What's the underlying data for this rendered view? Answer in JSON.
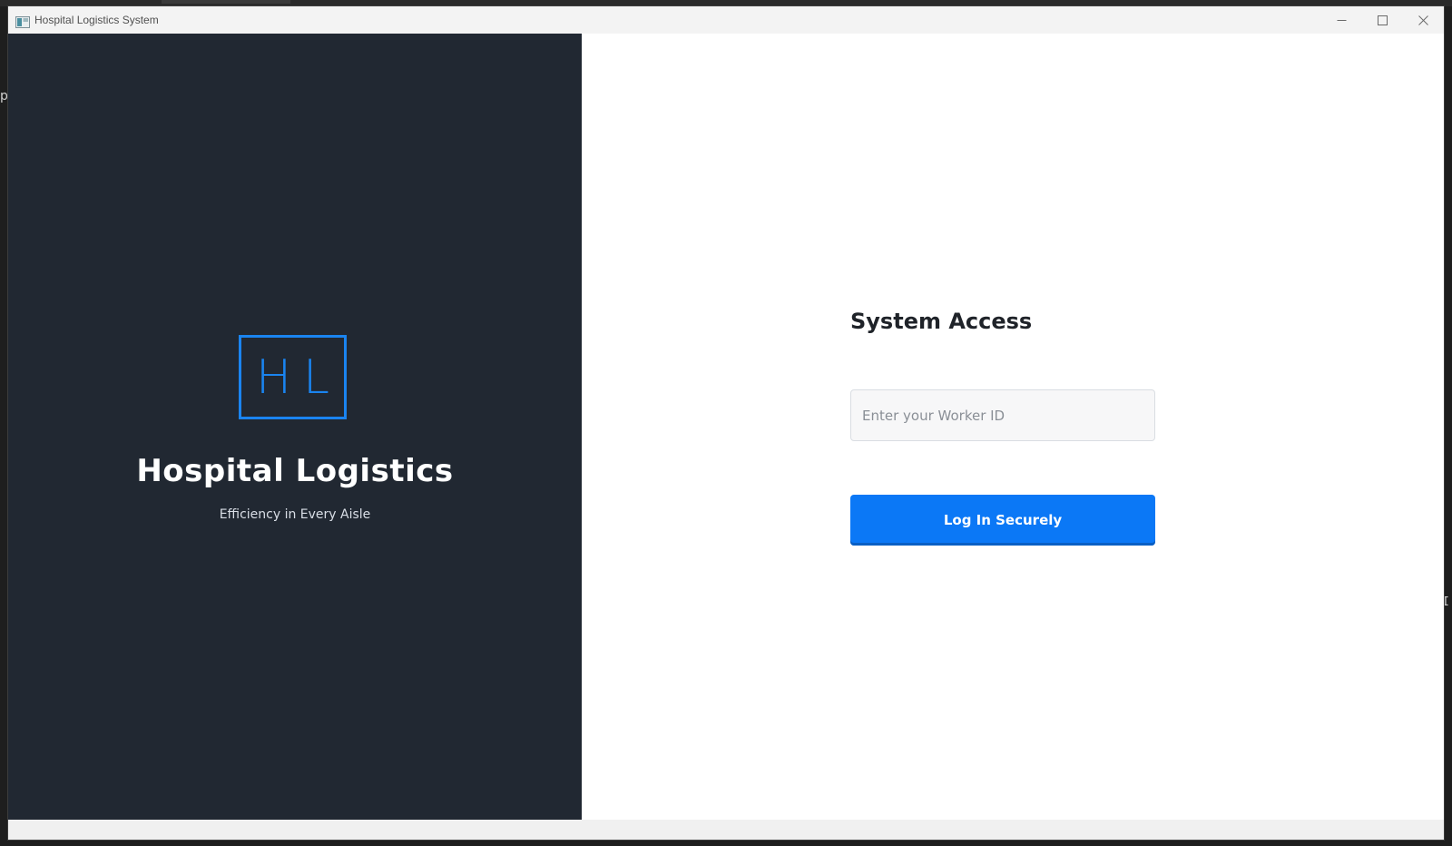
{
  "window": {
    "title": "Hospital Logistics System",
    "icon": "app-window-icon"
  },
  "desktop": {
    "left_glyph": "p",
    "right_glyph": "I"
  },
  "brand": {
    "logo_text": "HL",
    "title": "Hospital Logistics",
    "subtitle": "Efficiency in Every Aisle",
    "accent_color": "#1a84f0",
    "panel_color": "#212832"
  },
  "login": {
    "heading": "System Access",
    "worker_id_placeholder": "Enter your Worker ID",
    "worker_id_value": "",
    "submit_label": "Log In Securely",
    "button_color": "#0b78f6"
  }
}
